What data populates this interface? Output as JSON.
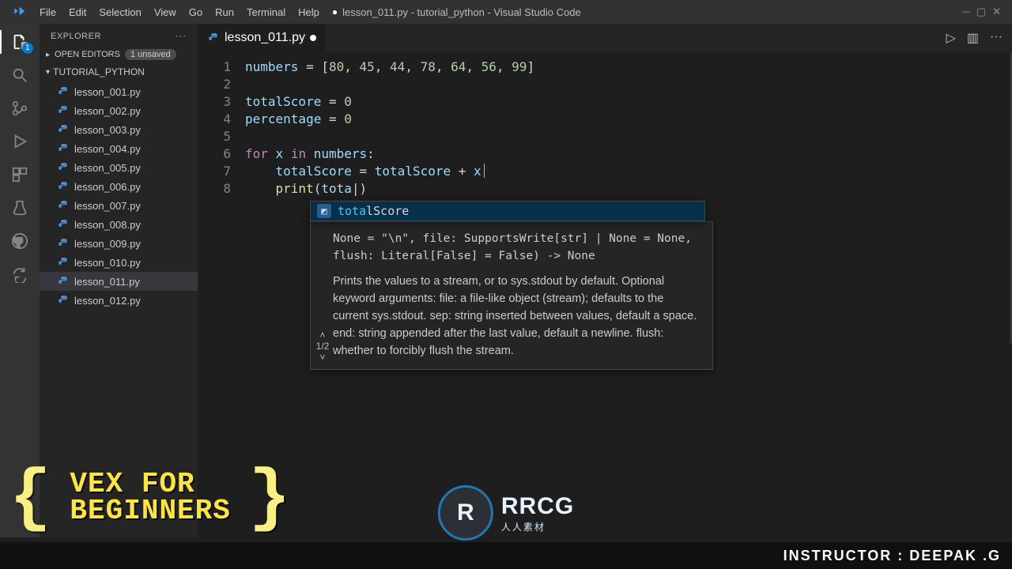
{
  "menubar": {
    "items": [
      "File",
      "Edit",
      "Selection",
      "View",
      "Go",
      "Run",
      "Terminal",
      "Help"
    ],
    "title_dirty_marker": "●",
    "title": "lesson_011.py - tutorial_python - Visual Studio Code"
  },
  "activitybar": {
    "badge": "1"
  },
  "sidebar": {
    "header": "EXPLORER",
    "open_editors_label": "OPEN EDITORS",
    "unsaved_pill": "1 unsaved",
    "folder_label": "TUTORIAL_PYTHON",
    "files": [
      "lesson_001.py",
      "lesson_002.py",
      "lesson_003.py",
      "lesson_004.py",
      "lesson_005.py",
      "lesson_006.py",
      "lesson_007.py",
      "lesson_008.py",
      "lesson_009.py",
      "lesson_010.py",
      "lesson_011.py",
      "lesson_012.py"
    ],
    "active_file_index": 10
  },
  "tab": {
    "label": "lesson_011.py"
  },
  "code": {
    "lines": [
      {
        "n": 1,
        "html": "<span class='tok-var'>numbers</span> <span class='tok-punc'>=</span> [<span class='tok-num'>80</span>, <span class='tok-num'>45</span>, <span class='tok-num'>44</span>, <span class='tok-num'>78</span>, <span class='tok-num'>64</span>, <span class='tok-num'>56</span>, <span class='tok-num'>99</span>]"
      },
      {
        "n": 2,
        "html": ""
      },
      {
        "n": 3,
        "html": "<span class='tok-var'>totalScore</span> <span class='tok-punc'>=</span> <span class='tok-num'>0</span>"
      },
      {
        "n": 4,
        "html": "<span class='tok-var'>percentage</span> <span class='tok-punc'>=</span> <span class='tok-num'>0</span>"
      },
      {
        "n": 5,
        "html": ""
      },
      {
        "n": 6,
        "html": "<span class='tok-kw'>for</span> <span class='tok-var'>x</span> <span class='tok-kw'>in</span> <span class='tok-var'>numbers</span>:"
      },
      {
        "n": 7,
        "html": "    <span class='tok-var'>totalScore</span> <span class='tok-punc'>=</span> <span class='tok-var'>totalScore</span> <span class='tok-punc'>+</span> <span class='tok-var'>x</span><span class='cursor-bar'></span>"
      },
      {
        "n": 8,
        "html": "    <span class='tok-func'>print</span>(<span class='tok-var'>tota</span>|)"
      }
    ]
  },
  "suggest": {
    "match": "tota",
    "rest": "lScore",
    "signature": "None = \"\\n\", file: SupportsWrite[str] | None = None,\nflush: Literal[False] = False) -> None",
    "doc": "Prints the values to a stream, or to sys.stdout by default. Optional keyword arguments: file: a file-like object (stream); defaults to the current sys.stdout. sep: string inserted between values, default a space. end: string appended after the last value, default a newline. flush: whether to forcibly flush the stream.",
    "position": "1/2"
  },
  "overlays": {
    "vex_line1": "VEX FOR",
    "vex_line2": "BEGINNERS",
    "logo_big": "RRCG",
    "logo_small": "人人素材",
    "instructor": "INSTRUCTOR : DEEPAK .G"
  }
}
